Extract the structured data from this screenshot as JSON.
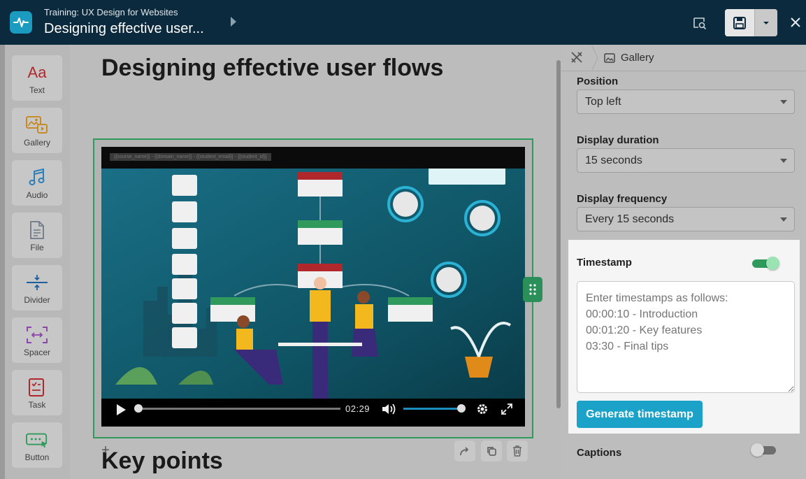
{
  "header": {
    "course_title": "Training: UX Design for Websites",
    "lesson_title": "Designing effective user..."
  },
  "palette": {
    "items": [
      {
        "label": "Text",
        "icon": "text-aa-icon"
      },
      {
        "label": "Gallery",
        "icon": "gallery-icon"
      },
      {
        "label": "Audio",
        "icon": "music-note-icon"
      },
      {
        "label": "File",
        "icon": "file-icon"
      },
      {
        "label": "Divider",
        "icon": "divider-icon"
      },
      {
        "label": "Spacer",
        "icon": "spacer-icon"
      },
      {
        "label": "Task",
        "icon": "task-icon"
      },
      {
        "label": "Button",
        "icon": "button-icon"
      }
    ],
    "text_glyph": "Aa"
  },
  "canvas": {
    "title": "Designing effective user flows",
    "watermark": "{{course_name}} - {{domain_name}} - {{student_email}} - {{student_id}}",
    "video": {
      "time": "02:29",
      "progress": 0.0,
      "volume": 1.0
    },
    "next_heading": "Key points"
  },
  "panel": {
    "breadcrumb_label": "Gallery",
    "position": {
      "label": "Position",
      "value": "Top left"
    },
    "duration": {
      "label": "Display duration",
      "value": "15 seconds"
    },
    "frequency": {
      "label": "Display frequency",
      "value": "Every 15 seconds"
    },
    "timestamp": {
      "label": "Timestamp",
      "enabled": true,
      "placeholder": "Enter timestamps as follows:\n00:00:10 - Introduction\n00:01:20 - Key features\n03:30 - Final tips",
      "generate_label": "Generate timestamp"
    },
    "captions": {
      "label": "Captions",
      "enabled": false
    }
  },
  "colors": {
    "topbar": "#0c2a3d",
    "accent_green": "#2f9a5c",
    "accent_blue": "#1aa2c9"
  }
}
